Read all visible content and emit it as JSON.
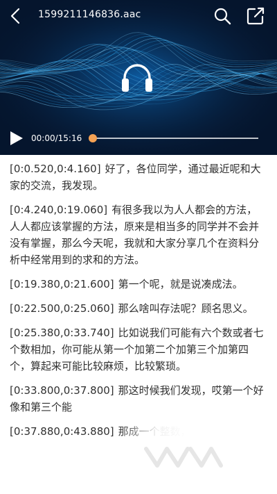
{
  "header": {
    "file_name": "1599211146836.aac",
    "back_icon": "back-arrow-icon",
    "search_icon": "search-icon",
    "share_icon": "share-icon"
  },
  "player": {
    "cover_icon": "headphones-icon",
    "play_icon": "play-icon",
    "time": "00:00/15:16",
    "progress": 0,
    "accent_color": "#f5a254"
  },
  "transcript": [
    {
      "timestamp": "[0:0.520,0:4.160]",
      "text": "好了，各位同学，通过最近呢和大家的交流，我发现。"
    },
    {
      "timestamp": "[0:4.240,0:19.060]",
      "text": "有很多我以为人人都会的方法，人人都应该掌握的方法，原来是相当多的同学并不会并没有掌握，那么今天呢，我就和大家分享几个在资料分析中经常用到的求和的方法。"
    },
    {
      "timestamp": "[0:19.380,0:21.600]",
      "text": "第一个呢，就是说凑成法。"
    },
    {
      "timestamp": "[0:22.500,0:25.060]",
      "text": "那么啥叫存法呢？顾名思义。"
    },
    {
      "timestamp": "[0:25.380,0:33.740]",
      "text": "比如说我们可能有六个数或者七个数相加，你可能从第一个加第二个加第三个加第四个，算起来可能比较麻烦，比较繁琐。"
    },
    {
      "timestamp": "[0:33.800,0:37.800]",
      "text": "那这时候我们发现，哎第一个好像和第三个能"
    },
    {
      "timestamp": "[0:37.880,0:43.880]",
      "text": "那成一个整数，那么这时"
    }
  ]
}
